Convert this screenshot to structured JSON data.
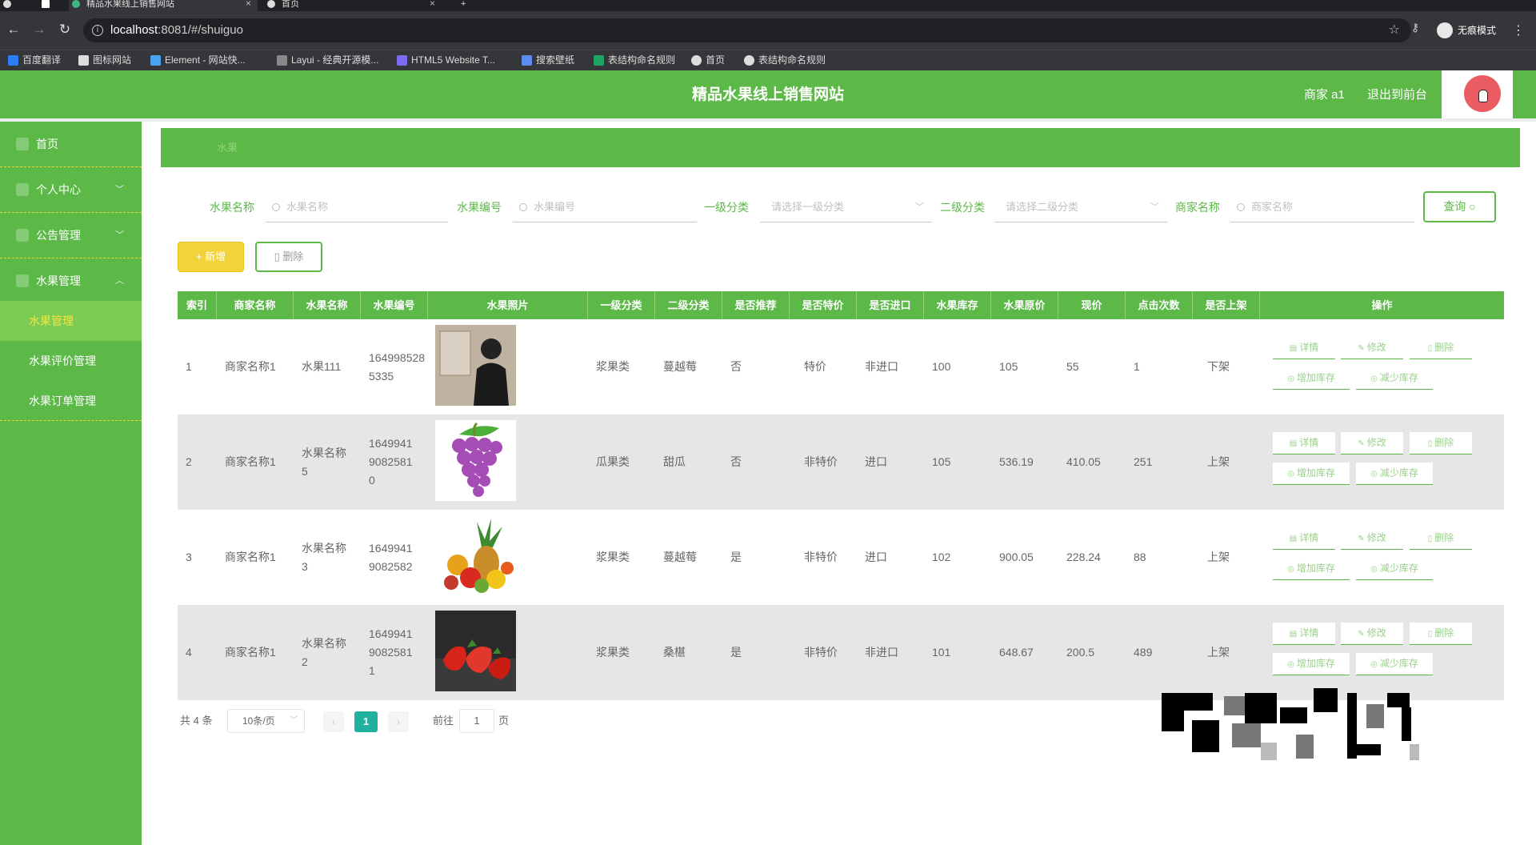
{
  "browser": {
    "tabs": [
      {
        "label": "精品水果线上销售网站",
        "active": true
      },
      {
        "label": "首页",
        "active": false
      }
    ],
    "new_tab": "+",
    "url_host": "localhost",
    "url_path": ":8081/#/shuiguo",
    "incognito_label": "无痕模式",
    "bookmarks": [
      {
        "label": "百度翻译",
        "color": "#2e7bf6"
      },
      {
        "label": "图标网站",
        "color": "#ffffff"
      },
      {
        "label": "Element - 网站快...",
        "color": "#4aa3f0"
      },
      {
        "label": "Layui - 经典开源模...",
        "color": "#dddddd"
      },
      {
        "label": "HTML5 Website T...",
        "color": "#7a6cf0"
      },
      {
        "label": "搜索壁纸",
        "color": "#5b8cf0"
      },
      {
        "label": "表结构命名规则",
        "color": "#1fa463"
      },
      {
        "label": "首页",
        "color": "#dddddd"
      },
      {
        "label": "表结构命名规则",
        "color": "#dddddd"
      }
    ]
  },
  "header": {
    "title": "精品水果线上销售网站",
    "user": "商家 a1",
    "exit": "退出到前台"
  },
  "sidebar": {
    "items": [
      {
        "label": "首页",
        "chevron": ""
      },
      {
        "label": "个人中心",
        "chevron": "﹀"
      },
      {
        "label": "公告管理",
        "chevron": "﹀"
      },
      {
        "label": "水果管理",
        "chevron": "︿"
      }
    ],
    "subitems": [
      {
        "label": "水果管理",
        "active": true
      },
      {
        "label": "水果评价管理",
        "active": false
      },
      {
        "label": "水果订单管理",
        "active": false
      }
    ]
  },
  "breadcrumb": "水果",
  "filters": {
    "name_label": "水果名称",
    "name_placeholder": "水果名称",
    "code_label": "水果编号",
    "code_placeholder": "水果编号",
    "cat1_label": "一级分类",
    "cat1_placeholder": "请选择一级分类",
    "cat2_label": "二级分类",
    "cat2_placeholder": "请选择二级分类",
    "merchant_label": "商家名称",
    "merchant_placeholder": "商家名称",
    "query_button": "查询"
  },
  "actions": {
    "add": "+ 新增",
    "delete": "删除"
  },
  "table": {
    "headers": [
      "索引",
      "商家名称",
      "水果名称",
      "水果编号",
      "水果照片",
      "一级分类",
      "二级分类",
      "是否推荐",
      "是否特价",
      "是否进口",
      "水果库存",
      "水果原价",
      "现价",
      "点击次数",
      "是否上架",
      "操作"
    ],
    "rows": [
      {
        "index": "1",
        "merchant": "商家名称1",
        "name": "水果111",
        "code": "1649985285335",
        "photo": "person",
        "cat1": "浆果类",
        "cat2": "蔓越莓",
        "recommend": "否",
        "special": "特价",
        "imported": "非进口",
        "stock": "100",
        "orig_price": "105",
        "price": "55",
        "clicks": "1",
        "onsale": "下架"
      },
      {
        "index": "2",
        "merchant": "商家名称1",
        "name": "水果名称5",
        "code": "16499419082581 0",
        "photo": "grapes",
        "cat1": "瓜果类",
        "cat2": "甜瓜",
        "recommend": "否",
        "special": "非特价",
        "imported": "进口",
        "stock": "105",
        "orig_price": "536.19",
        "price": "410.05",
        "clicks": "251",
        "onsale": "上架"
      },
      {
        "index": "3",
        "merchant": "商家名称1",
        "name": "水果名称3",
        "code": "16499419082582",
        "photo": "fruits",
        "cat1": "浆果类",
        "cat2": "蔓越莓",
        "recommend": "是",
        "special": "非特价",
        "imported": "进口",
        "stock": "102",
        "orig_price": "900.05",
        "price": "228.24",
        "clicks": "88",
        "onsale": "上架"
      },
      {
        "index": "4",
        "merchant": "商家名称1",
        "name": "水果名称2",
        "code": "16499419082581 1",
        "photo": "strawberry",
        "cat1": "浆果类",
        "cat2": "桑椹",
        "recommend": "是",
        "special": "非特价",
        "imported": "非进口",
        "stock": "101",
        "orig_price": "648.67",
        "price": "200.5",
        "clicks": "489",
        "onsale": "上架"
      }
    ],
    "row_actions": {
      "detail": "详情",
      "edit": "修改",
      "delete": "删除",
      "add_stock": "增加库存",
      "reduce_stock": "减少库存"
    }
  },
  "pagination": {
    "total": "共 4 条",
    "page_size": "10条/页",
    "prev": "‹",
    "next": "›",
    "current": "1",
    "goto_label": "前往",
    "goto_value": "1",
    "page_suffix": "页"
  },
  "colors": {
    "primary_green": "#5cb948",
    "accent_yellow": "#f2d43a",
    "page_teal": "#1fb19e"
  }
}
